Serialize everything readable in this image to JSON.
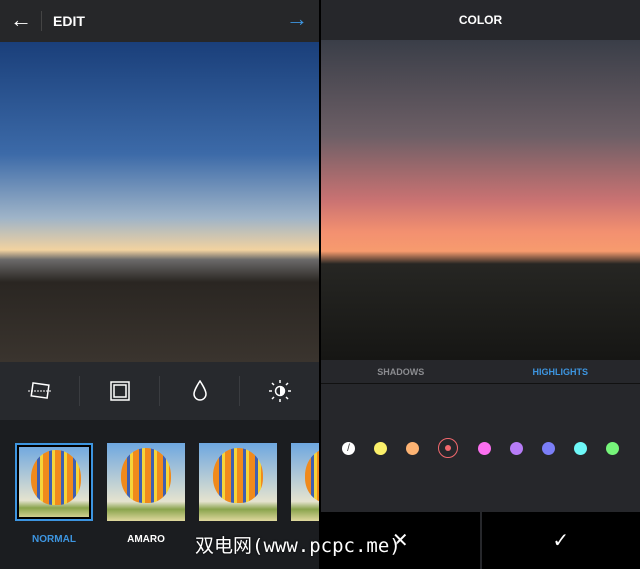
{
  "edit": {
    "title": "EDIT",
    "back_icon": "arrow-left-icon",
    "next_icon": "arrow-right-icon",
    "accent": "#3d95e0",
    "tools": [
      "adjust-icon",
      "border-icon",
      "drop-icon",
      "brightness-icon"
    ],
    "filters": [
      {
        "label": "NORMAL",
        "selected": true
      },
      {
        "label": "AMARO"
      },
      {
        "label": ""
      },
      {
        "label": ""
      }
    ]
  },
  "color": {
    "title": "COLOR",
    "tabs": [
      {
        "label": "SHADOWS"
      },
      {
        "label": "HIGHLIGHTS",
        "active": true
      }
    ],
    "swatches": [
      "#ffffff",
      "#fbf06a",
      "#fdb373",
      "#f2686d",
      "#fb6ff0",
      "#b77cf7",
      "#7b7ef7",
      "#6ef8f8",
      "#76f57a"
    ],
    "selected_index": 3,
    "cancel": "✕",
    "confirm": "✓"
  },
  "watermark": "双电网(www.pcpc.me)"
}
